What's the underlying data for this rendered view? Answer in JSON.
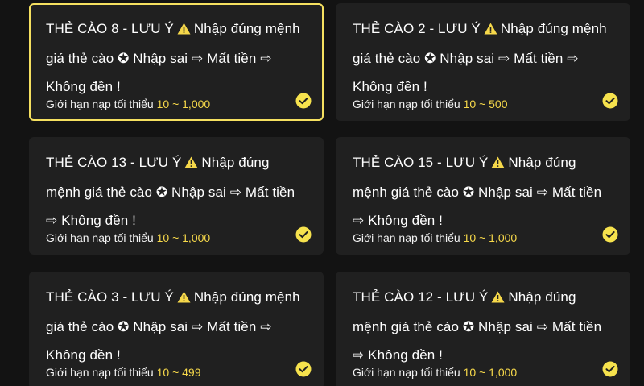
{
  "accent_color": "#f6d84a",
  "cards": [
    {
      "title_name": "THẺ CÀO 8 - LƯU Ý",
      "title_warning": "Nhập đúng mệnh giá thẻ cào ✪ Nhập sai ⇨ Mất tiền ⇨ Không đền !",
      "limit_label": "Giới hạn nạp tối thiểu",
      "limit_range": "10 ~ 1,000",
      "selected": true
    },
    {
      "title_name": "THẺ CÀO 2 - LƯU Ý",
      "title_warning": "Nhập đúng mệnh giá thẻ cào ✪ Nhập sai ⇨ Mất tiền ⇨ Không đền !",
      "limit_label": "Giới hạn nạp tối thiểu",
      "limit_range": "10 ~ 500",
      "selected": false
    },
    {
      "title_name": "THẺ CÀO 13 - LƯU Ý",
      "title_warning": "Nhập đúng mệnh giá thẻ cào ✪ Nhập sai ⇨ Mất tiền ⇨ Không đền !",
      "limit_label": "Giới hạn nạp tối thiểu",
      "limit_range": "10 ~ 1,000",
      "selected": false
    },
    {
      "title_name": "THẺ CÀO 15 - LƯU Ý",
      "title_warning": "Nhập đúng mệnh giá thẻ cào ✪ Nhập sai ⇨ Mất tiền ⇨ Không đền !",
      "limit_label": "Giới hạn nạp tối thiểu",
      "limit_range": "10 ~ 1,000",
      "selected": false
    },
    {
      "title_name": "THẺ CÀO 3 - LƯU Ý",
      "title_warning": "Nhập đúng mệnh giá thẻ cào ✪ Nhập sai ⇨ Mất tiền ⇨ Không đền !",
      "limit_label": "Giới hạn nạp tối thiểu",
      "limit_range": "10 ~ 499",
      "selected": false
    },
    {
      "title_name": "THẺ CÀO 12 - LƯU Ý",
      "title_warning": "Nhập đúng mệnh giá thẻ cào ✪ Nhập sai ⇨ Mất tiền ⇨ Không đền !",
      "limit_label": "Giới hạn nạp tối thiểu",
      "limit_range": "10 ~ 1,000",
      "selected": false
    }
  ]
}
